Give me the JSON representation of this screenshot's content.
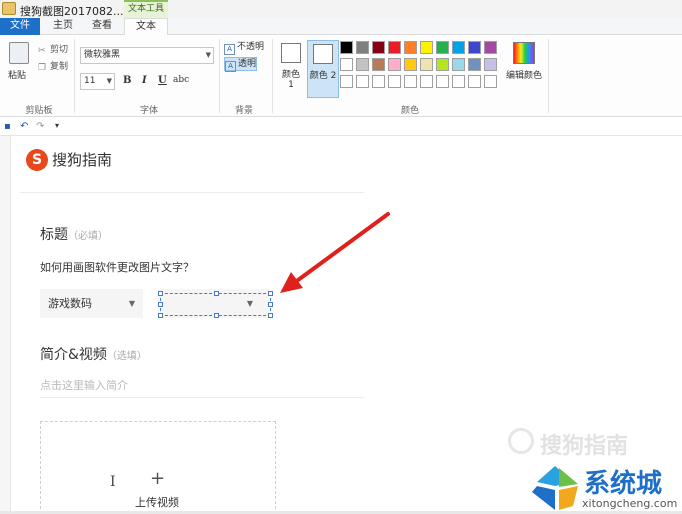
{
  "window": {
    "title": "搜狗截图2017082...",
    "context_tab": "文本工具"
  },
  "tabs": [
    {
      "label": "文件"
    },
    {
      "label": "主页"
    },
    {
      "label": "查看"
    },
    {
      "label": "文本"
    }
  ],
  "ribbon": {
    "clipboard": {
      "paste": "粘贴",
      "cut": "剪切",
      "copy": "复制",
      "group": "剪贴板"
    },
    "font": {
      "name": "微软雅黑",
      "size": "11",
      "bold": "B",
      "italic": "I",
      "underline": "U",
      "strikethrough": "abc",
      "group": "字体"
    },
    "background": {
      "opaque": "不透明",
      "transparent": "透明",
      "group": "背景",
      "selected": "透明"
    },
    "colors": {
      "color1": "颜色 1",
      "color2": "颜色 2",
      "color1_value": "#ffffff",
      "color2_value": "#ffffff",
      "edit": "编辑颜色",
      "group": "颜色",
      "palette_row1": [
        "#000000",
        "#7f7f7f",
        "#880015",
        "#ed1c24",
        "#ff7f27",
        "#fff200",
        "#22b14c",
        "#00a2e8",
        "#3f48cc",
        "#a349a4"
      ],
      "palette_row2": [
        "#ffffff",
        "#c3c3c3",
        "#b97a57",
        "#ffaec9",
        "#ffc90e",
        "#efe4b0",
        "#b5e61d",
        "#99d9ea",
        "#7092be",
        "#c8bfe7"
      ],
      "palette_row3": [
        "#ffffff",
        "#ffffff",
        "#ffffff",
        "#ffffff",
        "#ffffff",
        "#ffffff",
        "#ffffff",
        "#ffffff",
        "#ffffff",
        "#ffffff"
      ]
    }
  },
  "page": {
    "logo": "搜狗指南",
    "logo_mark": "S",
    "title_label": "标题",
    "title_hint": "（必填）",
    "question": "如何用画图软件更改图片文字？",
    "category": "游戏数码",
    "intro_label": "简介&视频",
    "intro_hint": "（选填）",
    "intro_placeholder": "点击这里输入简介",
    "upload_label": "上传视频",
    "upload_plus": "+",
    "cursor_glyph": "I"
  },
  "watermark": {
    "text": "搜狗指南"
  },
  "site_badge": {
    "name": "系统城",
    "url": "xitongcheng.com"
  },
  "accent": {
    "arrow": "#e0201b",
    "selection": "#4a78c2",
    "file_tab": "#1e6fc8",
    "brand": "#e8481c"
  }
}
